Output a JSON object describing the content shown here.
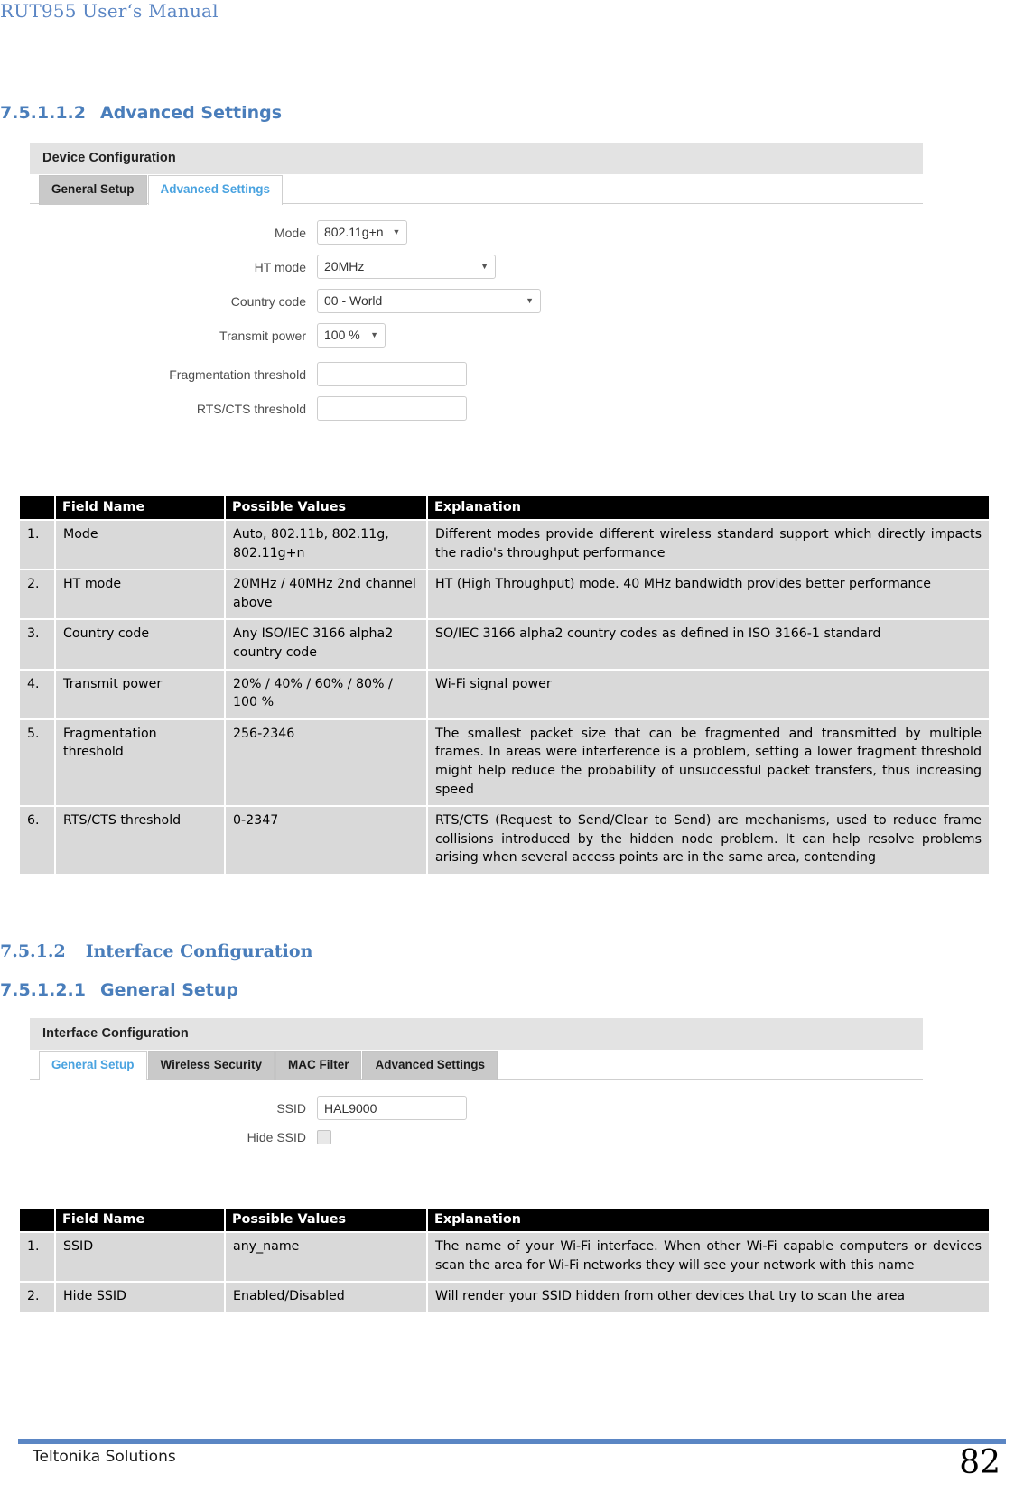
{
  "document": {
    "running_header": "RUT955 User‘s Manual",
    "footer_left": "Teltonika Solutions",
    "page_number": "82",
    "accent_blue": "#4a7ebb",
    "footer_rule_color": "#5b86c4"
  },
  "headings": {
    "advanced_settings": {
      "number": "7.5.1.1.2",
      "text": "Advanced Settings"
    },
    "interface_configuration": {
      "number": "7.5.1.2",
      "text": "Interface Configuration"
    },
    "general_setup": {
      "number": "7.5.1.2.1",
      "text": "General Setup"
    }
  },
  "device_config_widget": {
    "title": "Device Configuration",
    "tabs": [
      {
        "label": "General Setup",
        "active": false
      },
      {
        "label": "Advanced Settings",
        "active": true
      }
    ],
    "fields": {
      "mode": {
        "label": "Mode",
        "value": "802.11g+n"
      },
      "ht_mode": {
        "label": "HT mode",
        "value": "20MHz"
      },
      "country_code": {
        "label": "Country code",
        "value": "00 - World"
      },
      "transmit_power": {
        "label": "Transmit power",
        "value": "100 %"
      },
      "fragmentation_threshold": {
        "label": "Fragmentation threshold",
        "value": ""
      },
      "rts_cts_threshold": {
        "label": "RTS/CTS threshold",
        "value": ""
      }
    },
    "caret_glyph": "▼"
  },
  "interface_config_widget": {
    "title": "Interface Configuration",
    "tabs": [
      {
        "label": "General Setup",
        "active": true
      },
      {
        "label": "Wireless Security",
        "active": false
      },
      {
        "label": "MAC Filter",
        "active": false
      },
      {
        "label": "Advanced Settings",
        "active": false
      }
    ],
    "fields": {
      "ssid": {
        "label": "SSID",
        "value": "HAL9000"
      },
      "hide_ssid": {
        "label": "Hide SSID",
        "checked": false
      }
    }
  },
  "table_advanced": {
    "headers": {
      "num": "",
      "name": "Field Name",
      "values": "Possible Values",
      "explanation": "Explanation"
    },
    "rows": [
      {
        "num": "1.",
        "name": "Mode",
        "values": "Auto, 802.11b, 802.11g, 802.11g+n",
        "explanation": "Different modes provide different wireless standard support which directly impacts the radio's throughput performance"
      },
      {
        "num": "2.",
        "name": "HT mode",
        "values": "20MHz / 40MHz 2nd channel above",
        "explanation": "HT (High Throughput) mode. 40 MHz bandwidth provides better performance"
      },
      {
        "num": "3.",
        "name": "Country code",
        "values": "Any ISO/IEC 3166 alpha2 country code",
        "explanation": "SO/IEC 3166 alpha2 country codes as defined in ISO 3166-1 standard"
      },
      {
        "num": "4.",
        "name": "Transmit power",
        "values": "20% / 40% / 60% / 80% / 100 %",
        "explanation": "Wi-Fi signal power"
      },
      {
        "num": "5.",
        "name": "Fragmentation threshold",
        "values": "256-2346",
        "explanation": "The smallest packet size that can be fragmented and transmitted by multiple frames. In areas were interference is a problem, setting a lower fragment threshold might help reduce the probability of unsuccessful packet transfers, thus increasing speed"
      },
      {
        "num": "6.",
        "name": "RTS/CTS threshold",
        "values": "0-2347",
        "explanation": "RTS/CTS (Request to Send/Clear to Send) are mechanisms, used to reduce frame collisions introduced by the hidden node problem. It can help resolve problems arising when several access points are in the same area, contending"
      }
    ]
  },
  "table_general": {
    "headers": {
      "num": "",
      "name": "Field Name",
      "values": "Possible Values",
      "explanation": "Explanation"
    },
    "rows": [
      {
        "num": "1.",
        "name": "SSID",
        "values": "any_name",
        "explanation": "The name of your Wi-Fi interface. When other Wi-Fi capable computers or devices scan the area for Wi-Fi networks they will see your network with this name"
      },
      {
        "num": "2.",
        "name": "Hide SSID",
        "values": "Enabled/Disabled",
        "explanation": "Will render your SSID hidden from other devices that try to scan the area"
      }
    ]
  }
}
